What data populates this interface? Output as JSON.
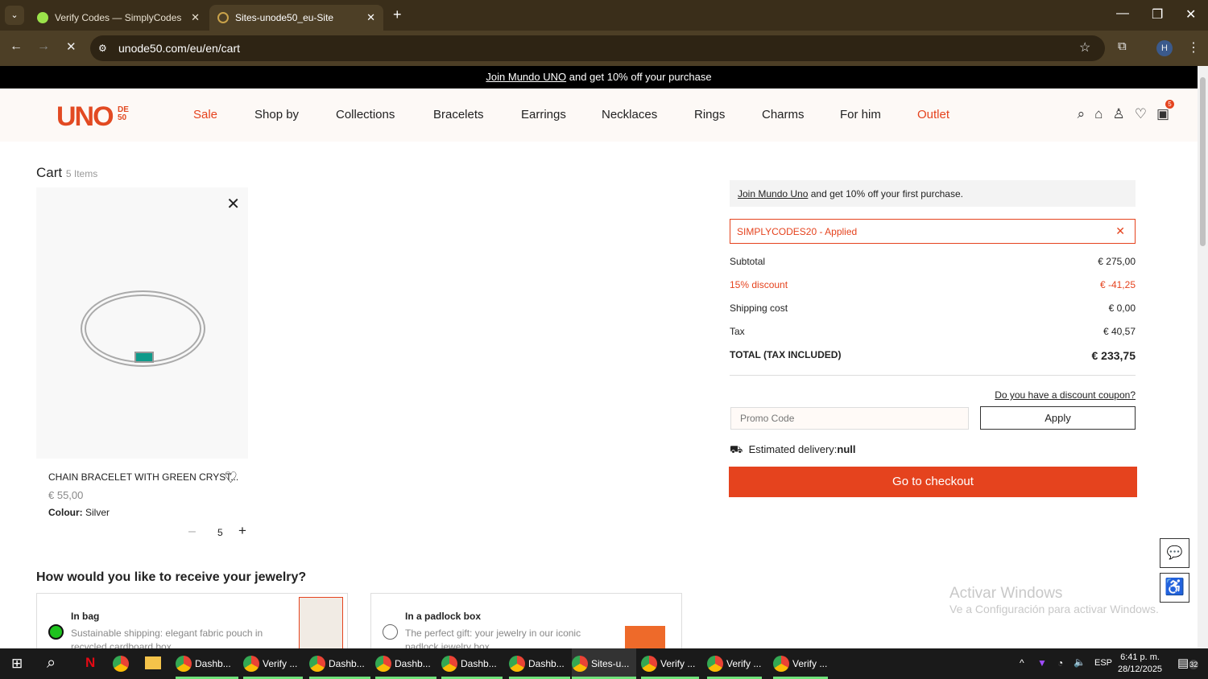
{
  "browser": {
    "tabs": [
      {
        "title": "Verify Codes — SimplyCodes"
      },
      {
        "title": "Sites-unode50_eu-Site"
      }
    ],
    "url": "unode50.com/eu/en/cart"
  },
  "promo_bar": {
    "link": "Join Mundo UNO",
    "text": " and get 10% off your purchase"
  },
  "header": {
    "logo": "UNO DE 50",
    "nav": [
      "Sale",
      "Shop by",
      "Collections",
      "Bracelets",
      "Earrings",
      "Necklaces",
      "Rings",
      "Charms",
      "For him",
      "Outlet"
    ],
    "cart_count": "5",
    "accent": "#e5431e"
  },
  "cart": {
    "title": "Cart",
    "count": "5 Items",
    "item": {
      "name": "CHAIN BRACELET WITH GREEN CRYST...",
      "price": "€ 55,00",
      "colour_label": "Colour:",
      "colour": "Silver",
      "quantity": "5"
    }
  },
  "summary": {
    "join_link": "Join Mundo Uno",
    "join_text": " and get 10% off your first purchase.",
    "coupon": "SIMPLYCODES20 - Applied",
    "rows": [
      {
        "label": "Subtotal",
        "value": "€ 275,00"
      },
      {
        "label": "15% discount",
        "value": "€ -41,25"
      },
      {
        "label": "Shipping cost",
        "value": "€ 0,00"
      },
      {
        "label": "Tax",
        "value": "€ 40,57"
      }
    ],
    "total_label": "TOTAL (TAX INCLUDED)",
    "total_value": "€ 233,75",
    "coupon_question": "Do you have a discount coupon?",
    "promo_placeholder": "Promo Code",
    "apply": "Apply",
    "delivery_label": "Estimated delivery:",
    "delivery_value": "null",
    "checkout": "Go to checkout"
  },
  "receive": {
    "title": "How would you like to receive your jewelry?",
    "options": [
      {
        "title": "In bag",
        "desc": "Sustainable shipping: elegant fabric pouch in recycled cardboard box",
        "selected": true
      },
      {
        "title": "In a padlock box",
        "desc": "The perfect gift: your jewelry in our iconic padlock jewelry box",
        "selected": false
      }
    ]
  },
  "watermark": {
    "title": "Activar Windows",
    "sub": "Ve a Configuración para activar Windows."
  },
  "taskbar": {
    "apps": [
      "Dashb...",
      "Verify ...",
      "Dashb...",
      "Dashb...",
      "Dashb...",
      "Dashb...",
      "Sites-u...",
      "Verify ...",
      "Verify ...",
      "Verify ..."
    ],
    "lang": "ESP",
    "time": "6:41 p. m.",
    "date": "28/12/2025",
    "notifications": "32"
  }
}
